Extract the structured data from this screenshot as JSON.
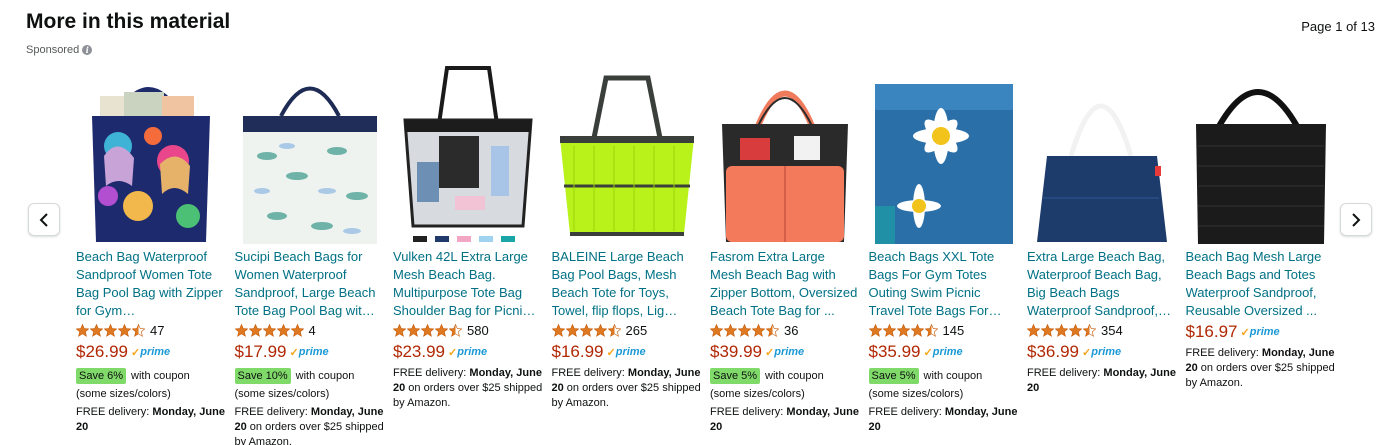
{
  "header": {
    "title": "More in this material",
    "sponsored": "Sponsored",
    "page_indicator": "Page 1 of 13"
  },
  "colors": {
    "link": "#007185",
    "price": "#b12704",
    "star": "#de7921",
    "save_badge": "#7fda69",
    "prime": "#1b99d6"
  },
  "products": [
    {
      "title": "Beach Bag Waterproof Sandproof Women Tote Bag Pool Bag with Zipper for Gym…",
      "rating": 4.5,
      "reviews": "47",
      "price": "$26.99",
      "prime": true,
      "save_badge": "Save 6%",
      "coupon_text": "with coupon",
      "sizes_note": "(some sizes/colors)",
      "delivery": "FREE delivery: ",
      "delivery_bold": "Monday, June 20",
      "delivery_suffix": "",
      "image": "floral-navy-beach-tote"
    },
    {
      "title": "Sucipi Beach Bags for Women Waterproof Sandproof, Large Beach Tote Bag Pool Bag wit…",
      "rating": 5,
      "reviews": "4",
      "price": "$17.99",
      "prime": true,
      "save_badge": "Save 10%",
      "coupon_text": "with coupon",
      "sizes_note": "(some sizes/colors)",
      "delivery": "FREE delivery: ",
      "delivery_bold": "Monday, June 20",
      "delivery_suffix": " on orders over $25 shipped by Amazon.",
      "image": "leaf-print-tote"
    },
    {
      "title": "Vulken 42L Extra Large Mesh Beach Bag. Multipurpose Tote Bag Shoulder Bag for Picni…",
      "rating": 4.5,
      "reviews": "580",
      "price": "$23.99",
      "prime": true,
      "save_badge": "",
      "coupon_text": "",
      "sizes_note": "",
      "delivery": "FREE delivery: ",
      "delivery_bold": "Monday, June 20",
      "delivery_suffix": " on orders over $25 shipped by Amazon.",
      "image": "clear-mesh-tote"
    },
    {
      "title": "BALEINE Large Beach Bag Pool Bags, Mesh Beach Tote for Toys, Towel, flip flops, Lig…",
      "rating": 4.5,
      "reviews": "265",
      "price": "$16.99",
      "prime": true,
      "save_badge": "",
      "coupon_text": "",
      "sizes_note": "",
      "delivery": "FREE delivery: ",
      "delivery_bold": "Monday, June 20",
      "delivery_suffix": " on orders over $25 shipped by Amazon.",
      "image": "lime-mesh-tote"
    },
    {
      "title": "Fasrom Extra Large Mesh Beach Bag with Zipper Bottom, Oversized Beach Tote Bag for ...",
      "rating": 4.5,
      "reviews": "36",
      "price": "$39.99",
      "prime": true,
      "save_badge": "Save 5%",
      "coupon_text": "with coupon",
      "sizes_note": "(some sizes/colors)",
      "delivery": "FREE delivery: ",
      "delivery_bold": "Monday, June 20",
      "delivery_suffix": "",
      "image": "coral-mesh-tote"
    },
    {
      "title": "Beach Bags XXL Tote Bags For Gym Totes Outing Swim Picnic Travel Tote Bags For…",
      "rating": 4.5,
      "reviews": "145",
      "price": "$35.99",
      "prime": true,
      "save_badge": "Save 5%",
      "coupon_text": "with coupon",
      "sizes_note": "(some sizes/colors)",
      "delivery": "FREE delivery: ",
      "delivery_bold": "Monday, June 20",
      "delivery_suffix": "",
      "image": "daisy-print-tote"
    },
    {
      "title": "Extra Large Beach Bag, Waterproof Beach Bag, Big Beach Bags Waterproof Sandproof,…",
      "rating": 4.5,
      "reviews": "354",
      "price": "$36.99",
      "prime": true,
      "save_badge": "",
      "coupon_text": "",
      "sizes_note": "",
      "delivery": "FREE delivery: ",
      "delivery_bold": "Monday, June 20",
      "delivery_suffix": "",
      "image": "navy-tote"
    },
    {
      "title": "Beach Bag Mesh Large Beach Bags and Totes Waterproof Sandproof, Reusable Oversized ...",
      "rating": 0,
      "reviews": "",
      "price": "$16.97",
      "prime": true,
      "save_badge": "",
      "coupon_text": "",
      "sizes_note": "",
      "delivery": "FREE delivery: ",
      "delivery_bold": "Monday, June 20",
      "delivery_suffix": " on orders over $25 shipped by Amazon.",
      "image": "black-mesh-tote"
    }
  ],
  "prime_label": "prime"
}
